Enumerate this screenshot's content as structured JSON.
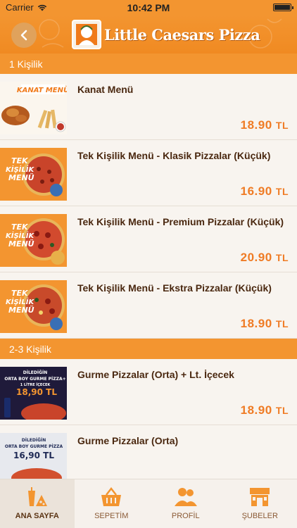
{
  "status": {
    "carrier": "Carrier",
    "time": "10:42 PM"
  },
  "header": {
    "brand": "Little Caesars Pizza"
  },
  "sections": [
    {
      "title": "1 Kişilik",
      "items": [
        {
          "name": "Kanat Menü",
          "price": "18.90",
          "currency": "TL",
          "image_text": [
            "KANAT MENÜ"
          ]
        },
        {
          "name": "Tek Kişilik Menü - Klasik Pizzalar (Küçük)",
          "price": "16.90",
          "currency": "TL",
          "image_text": [
            "TEK",
            "KİŞİLİK",
            "MENÜ"
          ]
        },
        {
          "name": "Tek Kişilik Menü - Premium Pizzalar (Küçük)",
          "price": "20.90",
          "currency": "TL",
          "image_text": [
            "TEK",
            "KİŞİLİK",
            "MENÜ"
          ]
        },
        {
          "name": "Tek Kişilik Menü - Ekstra Pizzalar (Küçük)",
          "price": "18.90",
          "currency": "TL",
          "image_text": [
            "TEK",
            "KİŞİLİK",
            "MENÜ"
          ]
        }
      ]
    },
    {
      "title": "2-3 Kişilik",
      "items": [
        {
          "name": "Gurme Pizzalar (Orta) + Lt. İçecek",
          "price": "18.90",
          "currency": "TL",
          "image_text": [
            "DİLEDİĞİN",
            "ORTA BOY GURME PİZZA+",
            "1 LİTRE İÇECEK",
            "18,90 TL"
          ]
        },
        {
          "name": "Gurme Pizzalar (Orta)",
          "price": "",
          "currency": "",
          "image_text": [
            "DİLEDİĞİN",
            "ORTA BOY GURME PİZZA",
            "16,90 TL"
          ]
        }
      ]
    }
  ],
  "tabs": [
    {
      "label": "ANA SAYFA",
      "icon": "drink-pizza-icon",
      "active": true
    },
    {
      "label": "SEPETİM",
      "icon": "basket-icon",
      "active": false
    },
    {
      "label": "PROFİL",
      "icon": "people-icon",
      "active": false
    },
    {
      "label": "ŞUBELER",
      "icon": "store-icon",
      "active": false
    }
  ],
  "colors": {
    "accent": "#f39530",
    "price": "#ef7b24",
    "title": "#4a2810"
  }
}
